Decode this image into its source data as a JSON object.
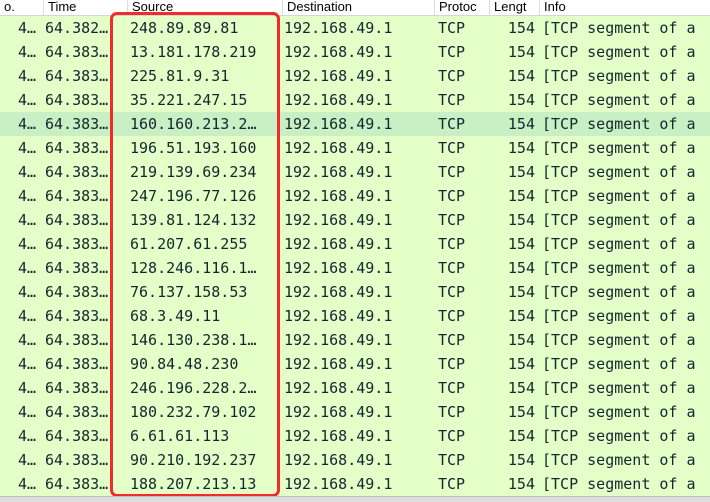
{
  "columns": {
    "no": "o.",
    "time": "Time",
    "source": "Source",
    "destination": "Destination",
    "protocol": "Protoc",
    "length": "Lengt",
    "info": "Info"
  },
  "selected_row": 4,
  "colors": {
    "row_background": "#e4ffc7",
    "selected_row_background": "#c8f0c4",
    "highlight_box": "#f22a2a"
  },
  "rows": [
    {
      "no": "4…",
      "time": "64.382…",
      "source": "248.89.89.81",
      "destination": "192.168.49.1",
      "protocol": "TCP",
      "length": "154",
      "info": "[TCP segment of a"
    },
    {
      "no": "4…",
      "time": "64.383…",
      "source": "13.181.178.219",
      "destination": "192.168.49.1",
      "protocol": "TCP",
      "length": "154",
      "info": "[TCP segment of a"
    },
    {
      "no": "4…",
      "time": "64.383…",
      "source": "225.81.9.31",
      "destination": "192.168.49.1",
      "protocol": "TCP",
      "length": "154",
      "info": "[TCP segment of a"
    },
    {
      "no": "4…",
      "time": "64.383…",
      "source": "35.221.247.15",
      "destination": "192.168.49.1",
      "protocol": "TCP",
      "length": "154",
      "info": "[TCP segment of a"
    },
    {
      "no": "4…",
      "time": "64.383…",
      "source": "160.160.213.2…",
      "destination": "192.168.49.1",
      "protocol": "TCP",
      "length": "154",
      "info": "[TCP segment of a"
    },
    {
      "no": "4…",
      "time": "64.383…",
      "source": "196.51.193.160",
      "destination": "192.168.49.1",
      "protocol": "TCP",
      "length": "154",
      "info": "[TCP segment of a"
    },
    {
      "no": "4…",
      "time": "64.383…",
      "source": "219.139.69.234",
      "destination": "192.168.49.1",
      "protocol": "TCP",
      "length": "154",
      "info": "[TCP segment of a"
    },
    {
      "no": "4…",
      "time": "64.383…",
      "source": "247.196.77.126",
      "destination": "192.168.49.1",
      "protocol": "TCP",
      "length": "154",
      "info": "[TCP segment of a"
    },
    {
      "no": "4…",
      "time": "64.383…",
      "source": "139.81.124.132",
      "destination": "192.168.49.1",
      "protocol": "TCP",
      "length": "154",
      "info": "[TCP segment of a"
    },
    {
      "no": "4…",
      "time": "64.383…",
      "source": "61.207.61.255",
      "destination": "192.168.49.1",
      "protocol": "TCP",
      "length": "154",
      "info": "[TCP segment of a"
    },
    {
      "no": "4…",
      "time": "64.383…",
      "source": "128.246.116.1…",
      "destination": "192.168.49.1",
      "protocol": "TCP",
      "length": "154",
      "info": "[TCP segment of a"
    },
    {
      "no": "4…",
      "time": "64.383…",
      "source": "76.137.158.53",
      "destination": "192.168.49.1",
      "protocol": "TCP",
      "length": "154",
      "info": "[TCP segment of a"
    },
    {
      "no": "4…",
      "time": "64.383…",
      "source": "68.3.49.11",
      "destination": "192.168.49.1",
      "protocol": "TCP",
      "length": "154",
      "info": "[TCP segment of a"
    },
    {
      "no": "4…",
      "time": "64.383…",
      "source": "146.130.238.1…",
      "destination": "192.168.49.1",
      "protocol": "TCP",
      "length": "154",
      "info": "[TCP segment of a"
    },
    {
      "no": "4…",
      "time": "64.383…",
      "source": "90.84.48.230",
      "destination": "192.168.49.1",
      "protocol": "TCP",
      "length": "154",
      "info": "[TCP segment of a"
    },
    {
      "no": "4…",
      "time": "64.383…",
      "source": "246.196.228.2…",
      "destination": "192.168.49.1",
      "protocol": "TCP",
      "length": "154",
      "info": "[TCP segment of a"
    },
    {
      "no": "4…",
      "time": "64.383…",
      "source": "180.232.79.102",
      "destination": "192.168.49.1",
      "protocol": "TCP",
      "length": "154",
      "info": "[TCP segment of a"
    },
    {
      "no": "4…",
      "time": "64.383…",
      "source": "6.61.61.113",
      "destination": "192.168.49.1",
      "protocol": "TCP",
      "length": "154",
      "info": "[TCP segment of a"
    },
    {
      "no": "4…",
      "time": "64.383…",
      "source": "90.210.192.237",
      "destination": "192.168.49.1",
      "protocol": "TCP",
      "length": "154",
      "info": "[TCP segment of a"
    },
    {
      "no": "4…",
      "time": "64.383…",
      "source": "188.207.213.13",
      "destination": "192.168.49.1",
      "protocol": "TCP",
      "length": "154",
      "info": "[TCP segment of a"
    }
  ]
}
